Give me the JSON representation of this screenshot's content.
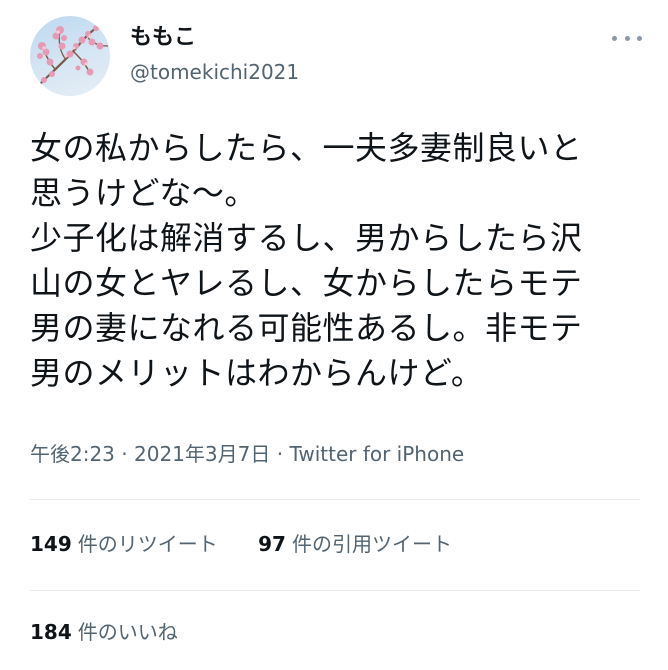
{
  "user": {
    "display_name": "ももこ",
    "handle": "@tomekichi2021"
  },
  "header": {
    "more_icon": "more-horizontal-icon"
  },
  "tweet": {
    "text": "女の私からしたら、一夫多妻制良いと\n思うけどな〜。\n少子化は解消するし、男からしたら沢\n山の女とヤレるし、女からしたらモテ\n男の妻になれる可能性あるし。非モテ\n男のメリットはわからんけど。",
    "time": "午後2:23",
    "date": "2021年3月7日",
    "separator": "·",
    "source": "Twitter for iPhone"
  },
  "stats": {
    "retweets_count": "149",
    "retweets_label": "件のリツイート",
    "quotes_count": "97",
    "quotes_label": "件の引用ツイート",
    "likes_count": "184",
    "likes_label": "件のいいね"
  },
  "colors": {
    "text": "#0f1419",
    "secondary": "#536471",
    "divider": "#e6ecf0"
  }
}
